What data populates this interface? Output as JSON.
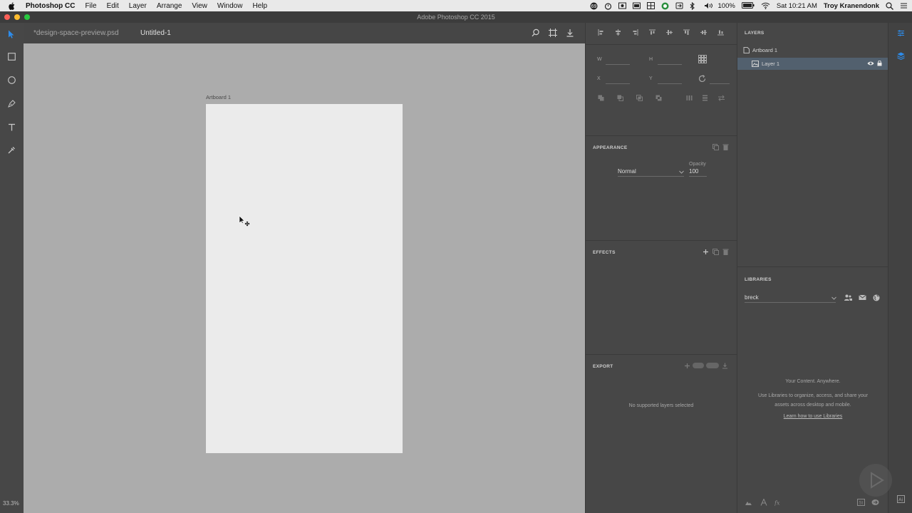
{
  "menubar": {
    "app_name": "Photoshop CC",
    "menus": [
      "File",
      "Edit",
      "Layer",
      "Arrange",
      "View",
      "Window",
      "Help"
    ],
    "battery": "100%",
    "clock": "Sat 10:21 AM",
    "user": "Troy Kranendonk"
  },
  "window": {
    "title": "Adobe Photoshop CC 2015"
  },
  "tabs": [
    {
      "label": "*design-space-preview.psd"
    },
    {
      "label": "Untitled-1",
      "active": true
    }
  ],
  "canvas": {
    "artboard_label": "Artboard 1",
    "zoom": "33.3%"
  },
  "properties": {
    "w_label": "W",
    "h_label": "H",
    "x_label": "X",
    "y_label": "Y",
    "appearance_title": "APPEARANCE",
    "blend_mode": "Normal",
    "opacity_label": "Opacity",
    "opacity_value": "100",
    "effects_title": "EFFECTS",
    "export_title": "EXPORT",
    "export_empty": "No supported layers selected"
  },
  "layers": {
    "title": "LAYERS",
    "items": [
      {
        "name": "Artboard 1",
        "type": "artboard"
      },
      {
        "name": "Layer 1",
        "type": "layer",
        "selected": true
      }
    ]
  },
  "libraries": {
    "title": "LIBRARIES",
    "selected_library": "breck",
    "empty_title": "Your Content. Anywhere.",
    "empty_body": "Use Libraries to organize, access, and share your assets across desktop and mobile.",
    "learn_link": "Learn how to use Libraries"
  },
  "colors": {
    "accent": "#2d8ceb",
    "canvas_bg": "#acacac",
    "artboard": "#ebebeb",
    "panel_bg": "#474747",
    "selected_row": "#52606e"
  }
}
